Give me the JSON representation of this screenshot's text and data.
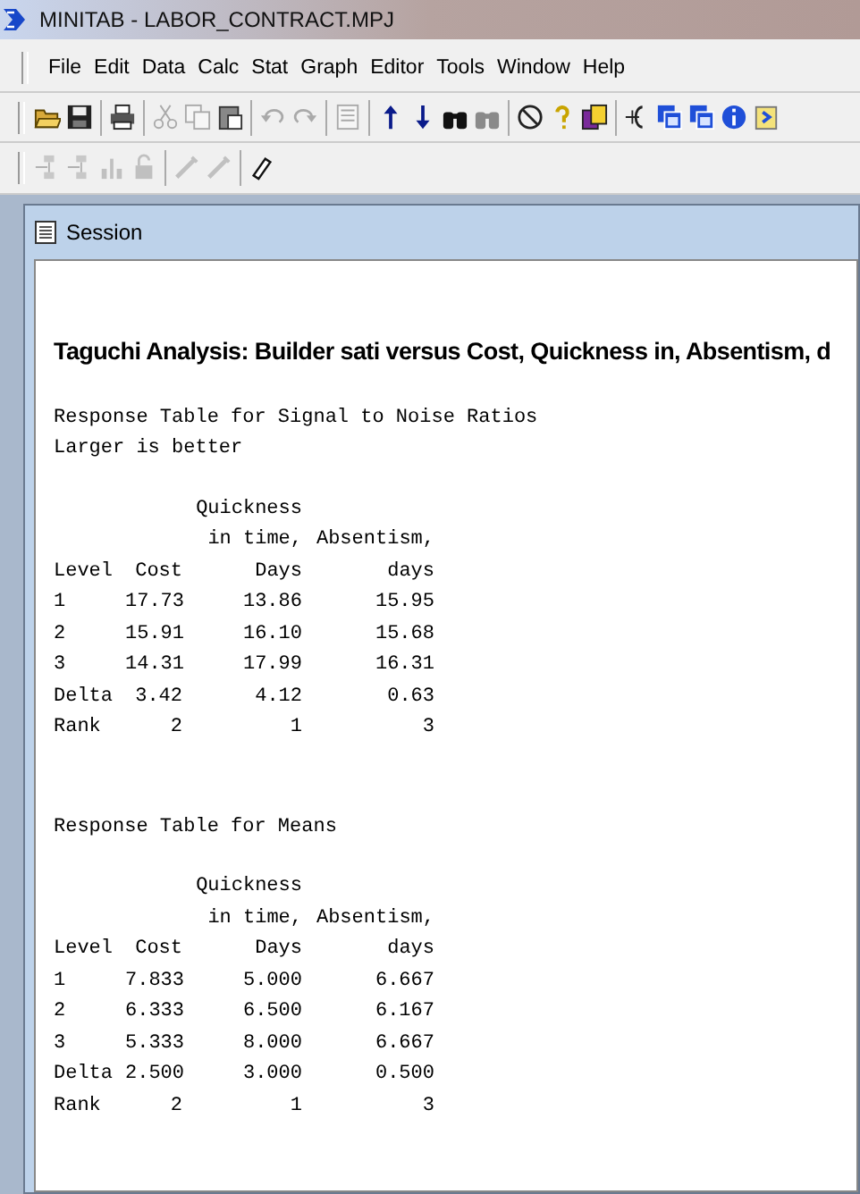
{
  "window": {
    "title": "MINITAB - LABOR_CONTRACT.MPJ"
  },
  "menu": [
    "File",
    "Edit",
    "Data",
    "Calc",
    "Stat",
    "Graph",
    "Editor",
    "Tools",
    "Window",
    "Help"
  ],
  "toolbar_1": [
    {
      "kind": "open",
      "disabled": false
    },
    {
      "kind": "save",
      "disabled": false
    },
    {
      "kind": "sep"
    },
    {
      "kind": "print",
      "disabled": false
    },
    {
      "kind": "sep"
    },
    {
      "kind": "cut",
      "disabled": true
    },
    {
      "kind": "copy",
      "disabled": true
    },
    {
      "kind": "paste",
      "disabled": false
    },
    {
      "kind": "sep"
    },
    {
      "kind": "undo",
      "disabled": true
    },
    {
      "kind": "redo",
      "disabled": true
    },
    {
      "kind": "sep"
    },
    {
      "kind": "sheet",
      "disabled": true
    },
    {
      "kind": "sep"
    },
    {
      "kind": "up",
      "disabled": false
    },
    {
      "kind": "down",
      "disabled": false
    },
    {
      "kind": "find",
      "disabled": false
    },
    {
      "kind": "replace",
      "disabled": true
    },
    {
      "kind": "sep"
    },
    {
      "kind": "cancel",
      "disabled": false
    },
    {
      "kind": "help",
      "disabled": false
    },
    {
      "kind": "project",
      "disabled": false
    },
    {
      "kind": "sep"
    },
    {
      "kind": "insert",
      "disabled": false
    },
    {
      "kind": "worksheet",
      "disabled": false
    },
    {
      "kind": "graphs",
      "disabled": false
    },
    {
      "kind": "info",
      "disabled": false
    },
    {
      "kind": "history",
      "disabled": false
    }
  ],
  "toolbar_2": [
    {
      "kind": "add",
      "disabled": true
    },
    {
      "kind": "remove",
      "disabled": true
    },
    {
      "kind": "bars",
      "disabled": true
    },
    {
      "kind": "reset",
      "disabled": true
    },
    {
      "kind": "sep"
    },
    {
      "kind": "brush",
      "disabled": true
    },
    {
      "kind": "brush",
      "disabled": true
    },
    {
      "kind": "sep"
    },
    {
      "kind": "eraser",
      "disabled": false
    }
  ],
  "session": {
    "title": "Session",
    "heading": "Taguchi Analysis: Builder sati versus Cost, Quickness in, Absentism, d",
    "tables": [
      {
        "title_lines": [
          "Response Table for Signal to Noise Ratios",
          "Larger is better"
        ],
        "header_rows": [
          [
            "",
            "",
            "Quickness",
            ""
          ],
          [
            "",
            "",
            "in time,",
            "Absentism,"
          ],
          [
            "Level",
            "Cost",
            "Days",
            "days"
          ]
        ],
        "rows": [
          [
            "1",
            "17.73",
            "13.86",
            "15.95"
          ],
          [
            "2",
            "15.91",
            "16.10",
            "15.68"
          ],
          [
            "3",
            "14.31",
            "17.99",
            "16.31"
          ],
          [
            "Delta",
            "3.42",
            "4.12",
            "0.63"
          ],
          [
            "Rank",
            "2",
            "1",
            "3"
          ]
        ]
      },
      {
        "title_lines": [
          "Response Table for Means"
        ],
        "header_rows": [
          [
            "",
            "",
            "Quickness",
            ""
          ],
          [
            "",
            "",
            "in time,",
            "Absentism,"
          ],
          [
            "Level",
            "Cost",
            "Days",
            "days"
          ]
        ],
        "rows": [
          [
            "1",
            "7.833",
            "5.000",
            "6.667"
          ],
          [
            "2",
            "6.333",
            "6.500",
            "6.167"
          ],
          [
            "3",
            "5.333",
            "8.000",
            "6.667"
          ],
          [
            "Delta",
            "2.500",
            "3.000",
            "0.500"
          ],
          [
            "Rank",
            "2",
            "1",
            "3"
          ]
        ]
      }
    ]
  }
}
